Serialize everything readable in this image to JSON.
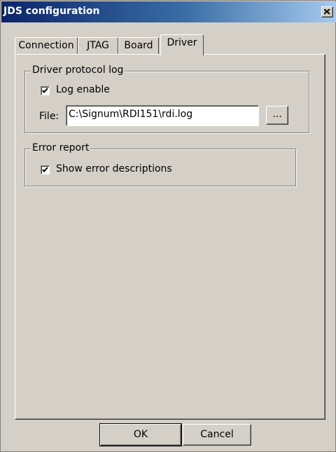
{
  "window": {
    "title": "JDS configuration"
  },
  "tabs": [
    "Connection",
    "JTAG",
    "Board",
    "Driver"
  ],
  "active_tab": "Driver",
  "driver_log": {
    "group_title": "Driver protocol log",
    "log_enable_label": "Log enable",
    "log_enable_checked": true,
    "file_label": "File:",
    "file_value": "C:\\Signum\\RDI151\\rdi.log",
    "browse_label": "..."
  },
  "error_report": {
    "group_title": "Error report",
    "show_desc_label": "Show error descriptions",
    "show_desc_checked": true
  },
  "buttons": {
    "ok": "OK",
    "cancel": "Cancel"
  }
}
